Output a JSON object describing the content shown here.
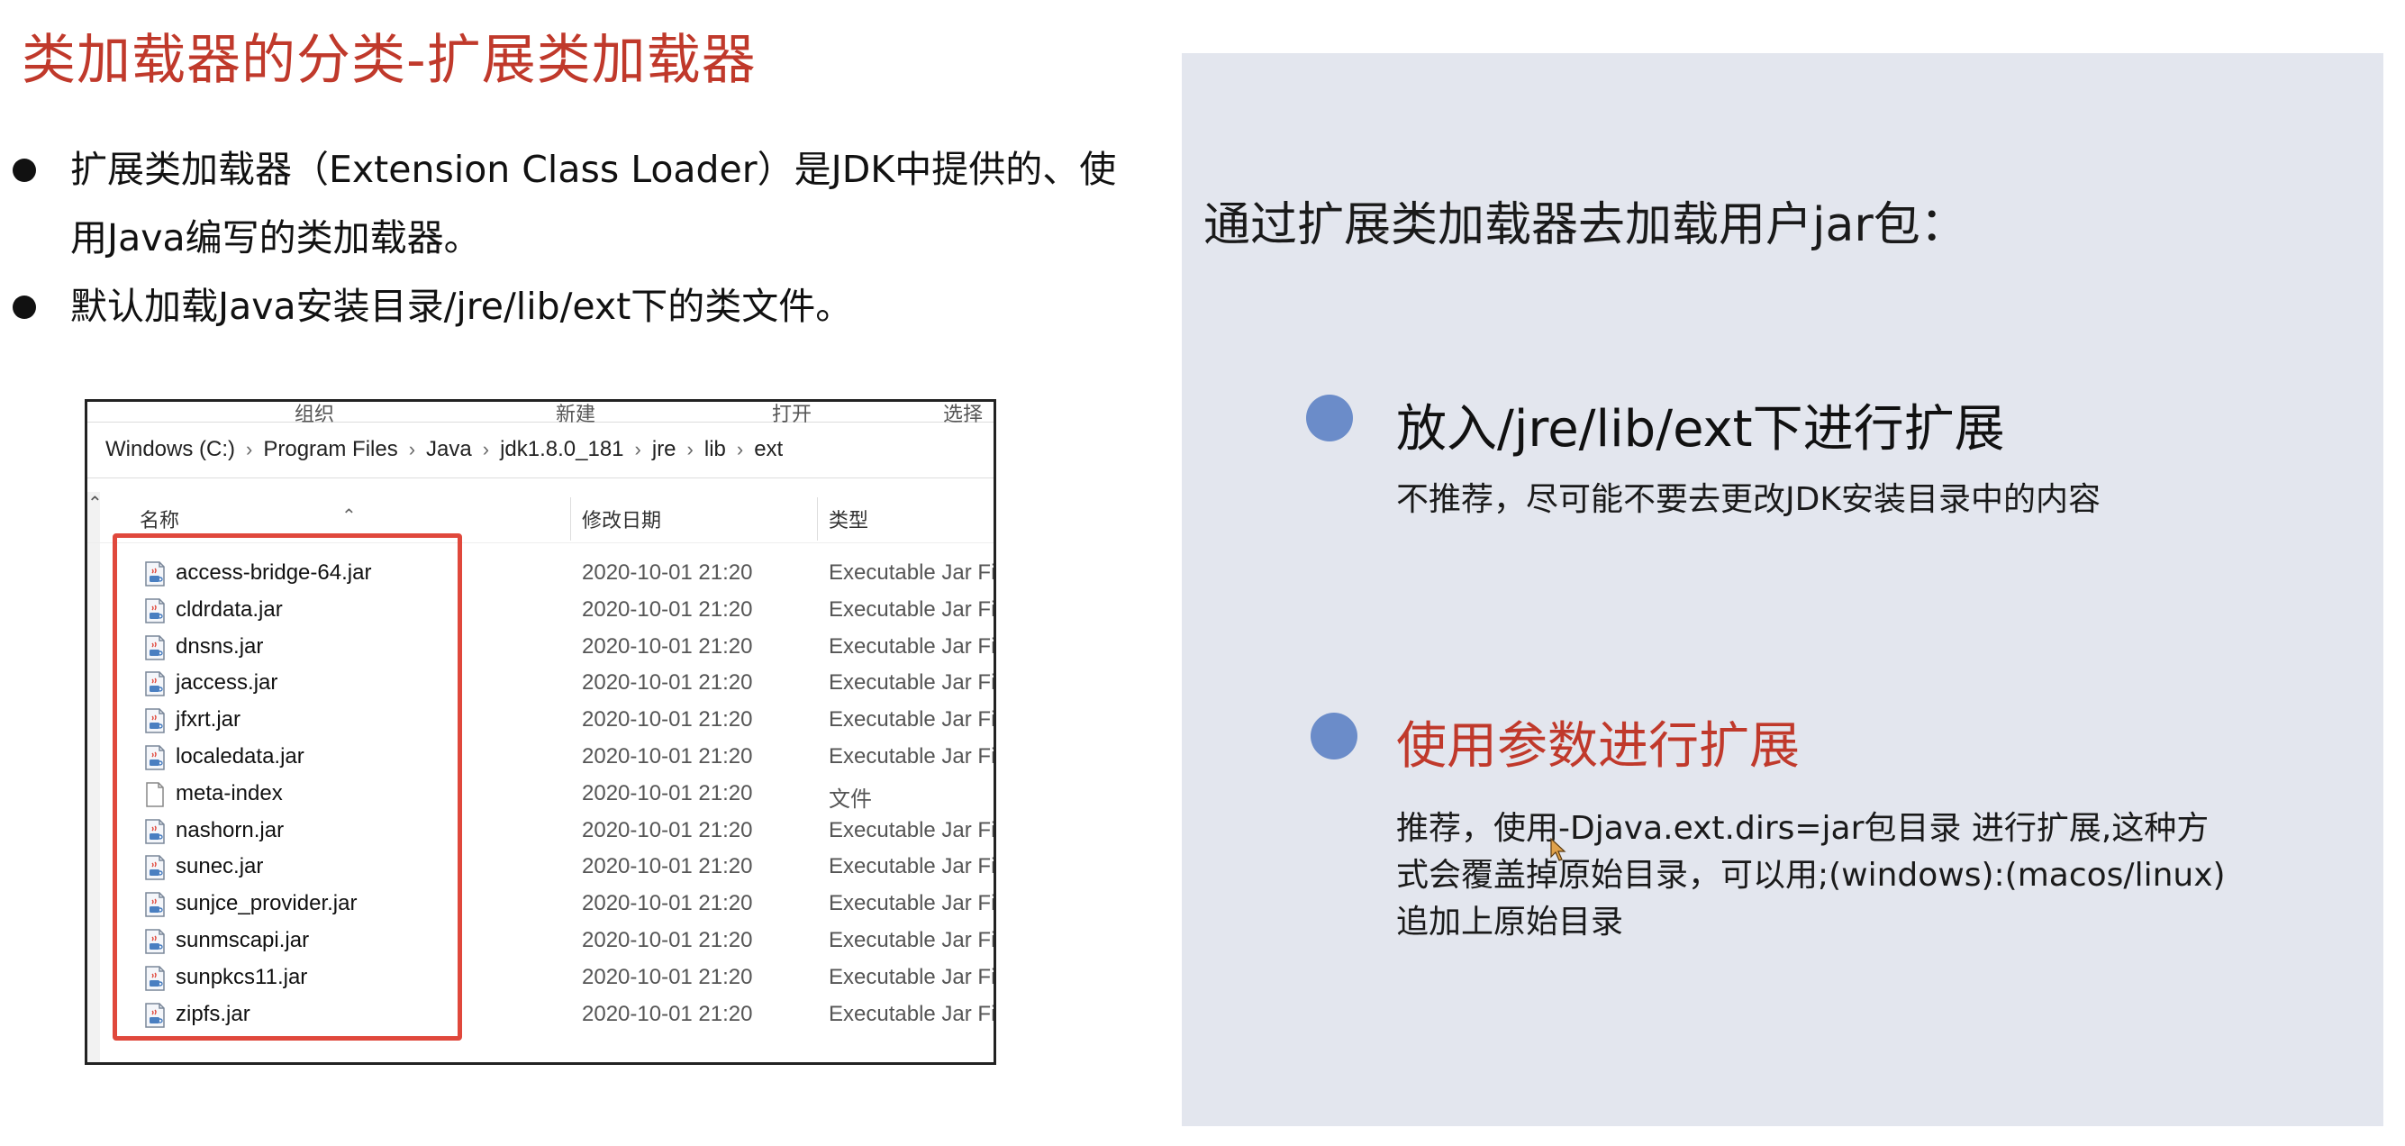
{
  "title": "类加载器的分类-扩展类加载器",
  "bullets": [
    "扩展类加载器（Extension Class Loader）是JDK中提供的、使用Java编写的类加载器。",
    "默认加载Java安装目录/jre/lib/ext下的类文件。"
  ],
  "explorer": {
    "ribbon": [
      "组织",
      "新建",
      "打开",
      "选择"
    ],
    "breadcrumb": [
      "Windows (C:)",
      "Program Files",
      "Java",
      "jdk1.8.0_181",
      "jre",
      "lib",
      "ext"
    ],
    "columns": {
      "name": "名称",
      "date": "修改日期",
      "type": "类型"
    },
    "files": [
      {
        "name": "access-bridge-64.jar",
        "date": "2020-10-01 21:20",
        "type": "Executable Jar Fi",
        "icon": "jar-file-icon"
      },
      {
        "name": "cldrdata.jar",
        "date": "2020-10-01 21:20",
        "type": "Executable Jar Fi",
        "icon": "jar-file-icon"
      },
      {
        "name": "dnsns.jar",
        "date": "2020-10-01 21:20",
        "type": "Executable Jar Fi",
        "icon": "jar-file-icon"
      },
      {
        "name": "jaccess.jar",
        "date": "2020-10-01 21:20",
        "type": "Executable Jar Fi",
        "icon": "jar-file-icon"
      },
      {
        "name": "jfxrt.jar",
        "date": "2020-10-01 21:20",
        "type": "Executable Jar Fi",
        "icon": "jar-file-icon"
      },
      {
        "name": "localedata.jar",
        "date": "2020-10-01 21:20",
        "type": "Executable Jar Fi",
        "icon": "jar-file-icon"
      },
      {
        "name": "meta-index",
        "date": "2020-10-01 21:20",
        "type": "文件",
        "icon": "blank-file-icon"
      },
      {
        "name": "nashorn.jar",
        "date": "2020-10-01 21:20",
        "type": "Executable Jar Fi",
        "icon": "jar-file-icon"
      },
      {
        "name": "sunec.jar",
        "date": "2020-10-01 21:20",
        "type": "Executable Jar Fi",
        "icon": "jar-file-icon"
      },
      {
        "name": "sunjce_provider.jar",
        "date": "2020-10-01 21:20",
        "type": "Executable Jar Fi",
        "icon": "jar-file-icon"
      },
      {
        "name": "sunmscapi.jar",
        "date": "2020-10-01 21:20",
        "type": "Executable Jar Fi",
        "icon": "jar-file-icon"
      },
      {
        "name": "sunpkcs11.jar",
        "date": "2020-10-01 21:20",
        "type": "Executable Jar Fi",
        "icon": "jar-file-icon"
      },
      {
        "name": "zipfs.jar",
        "date": "2020-10-01 21:20",
        "type": "Executable Jar Fi",
        "icon": "jar-file-icon"
      }
    ]
  },
  "panel": {
    "heading": "通过扩展类加载器去加载用户jar包：",
    "point1": {
      "title": "放入/jre/lib/ext下进行扩展",
      "desc": "不推荐，尽可能不要去更改JDK安装目录中的内容"
    },
    "point2": {
      "title": "使用参数进行扩展",
      "desc_lines": [
        "推荐，使用-Djava.ext.dirs=jar包目录 进行扩展,这种方",
        "式会覆盖掉原始目录，可以用;(windows):(macos/linux)",
        "追加上原始目录"
      ]
    }
  },
  "colors": {
    "title_red": "#c0392b",
    "highlight_box": "#e0483c",
    "panel_bg": "#e3e6ee",
    "bullet_blue": "#6b8cc9"
  }
}
